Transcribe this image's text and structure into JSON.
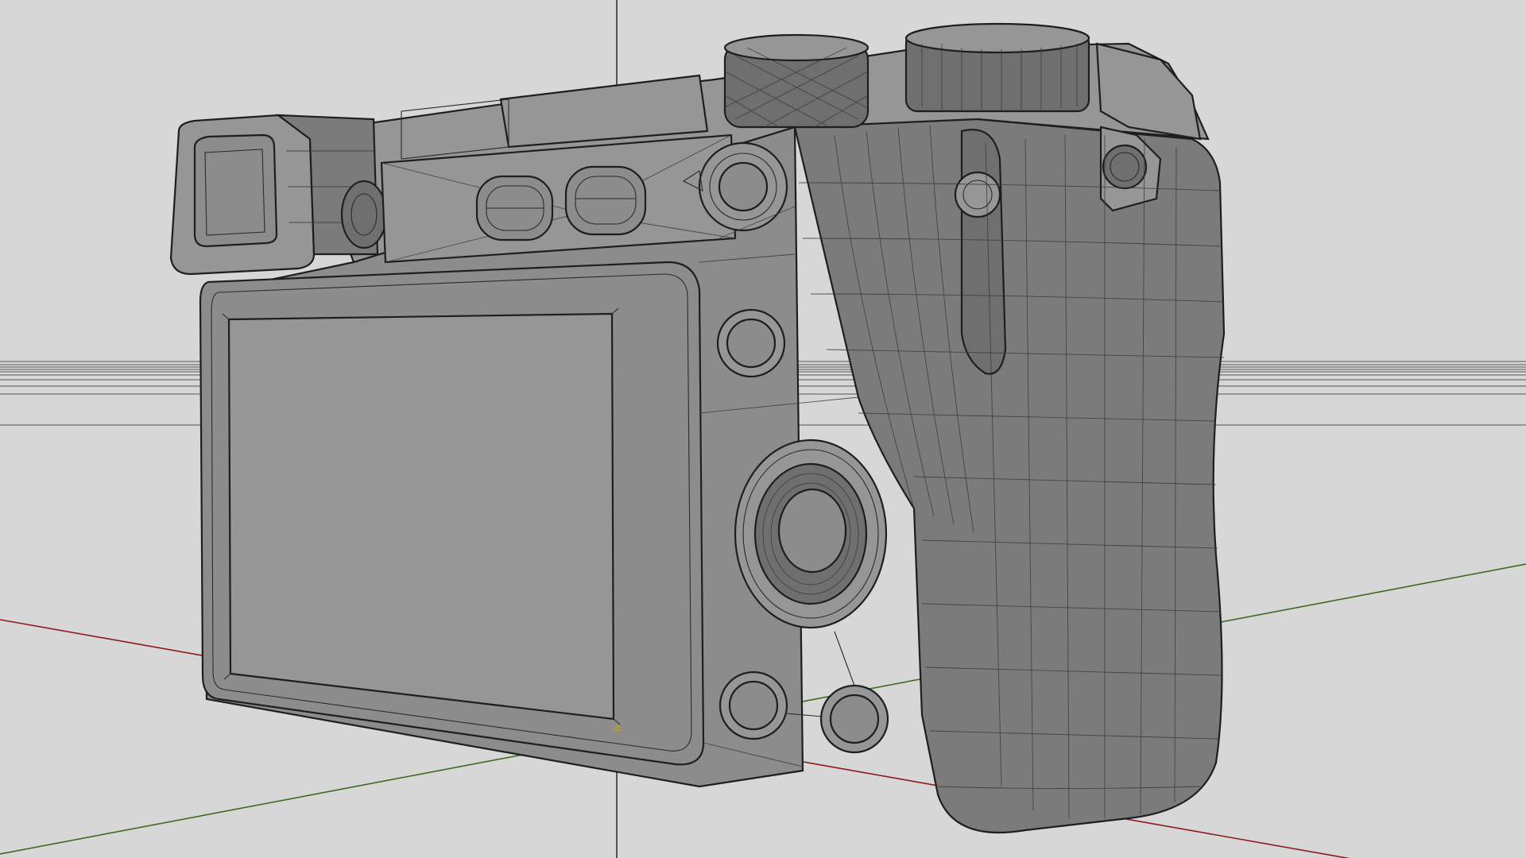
{
  "viewport": {
    "background_color": "#d7d7d7",
    "model_color": "#8a8a8a",
    "edge_color": "#1e1e1e"
  },
  "axes": {
    "x_axis_color": "#8b1a1a",
    "y_axis_color": "#3f6b1f",
    "z_axis_color": "#1a1a1a",
    "horizon_color": "#555555"
  },
  "objects": [
    {
      "name": "camera-body",
      "kind": "mesh"
    },
    {
      "name": "lcd-screen",
      "kind": "mesh"
    },
    {
      "name": "viewfinder-eyecup",
      "kind": "mesh"
    },
    {
      "name": "mode-dial",
      "kind": "mesh"
    },
    {
      "name": "control-wheel",
      "kind": "mesh"
    },
    {
      "name": "hand-grip",
      "kind": "mesh"
    }
  ],
  "origin_marker_color": "#d4a000"
}
